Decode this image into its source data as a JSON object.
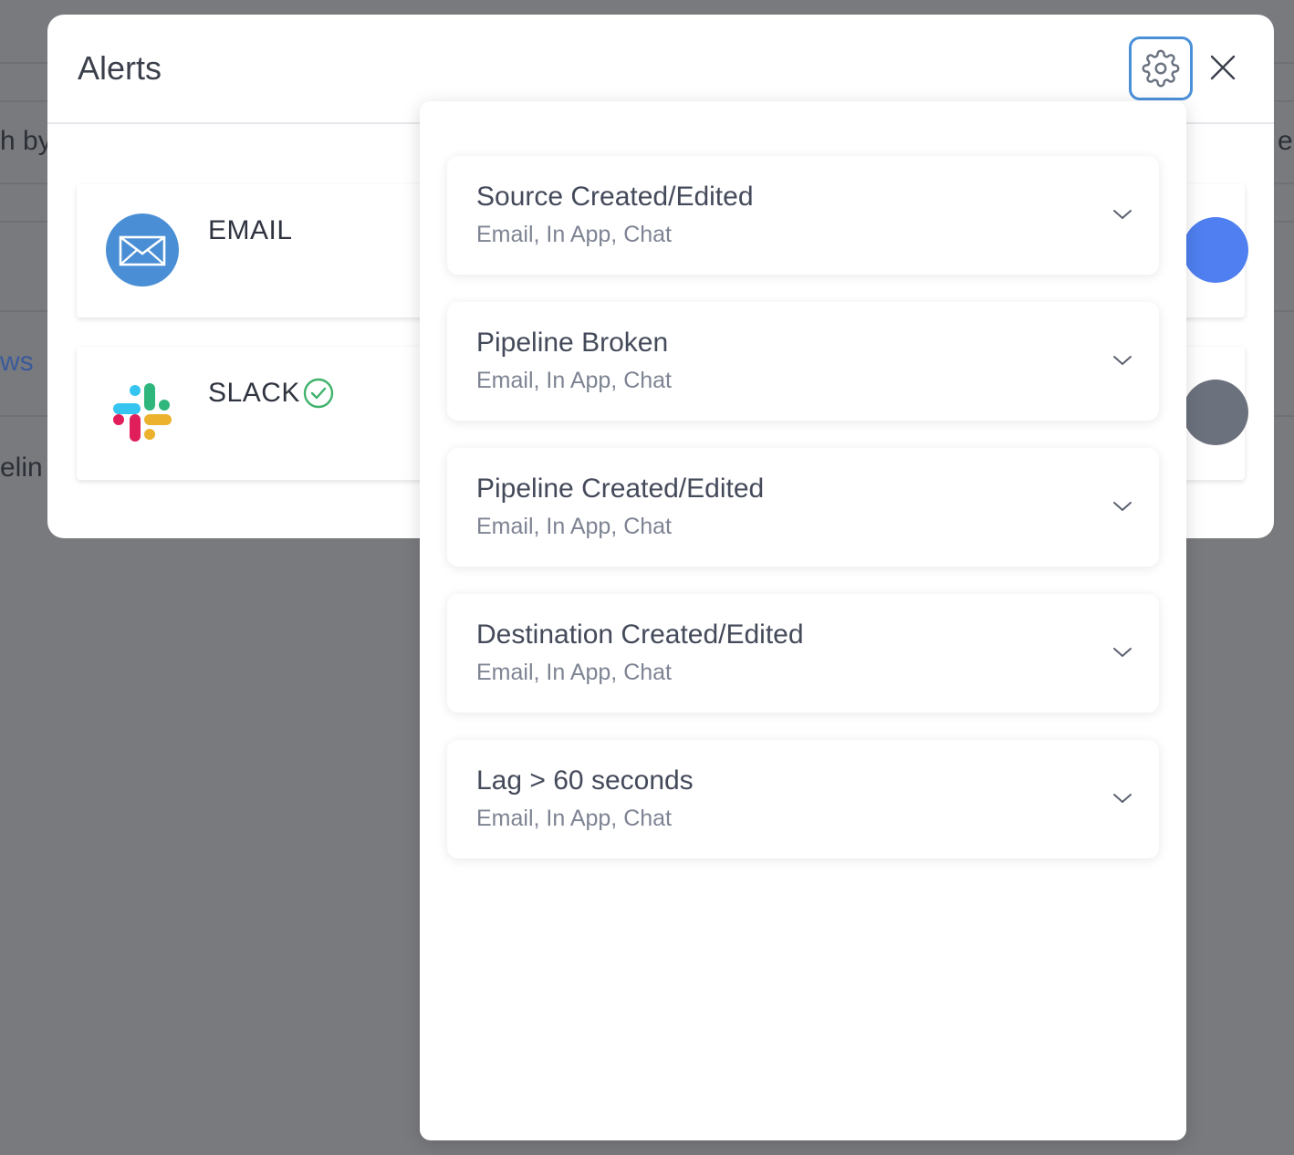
{
  "modal": {
    "title": "Alerts"
  },
  "background": {
    "frag1": "h by",
    "frag2": "ws",
    "frag3": "elin",
    "frag4": "e"
  },
  "channels": [
    {
      "label": "EMAIL",
      "icon": "envelope-icon",
      "connected": false,
      "enabled": true
    },
    {
      "label": "SLACK",
      "icon": "slack-icon",
      "connected": true,
      "enabled": false
    }
  ],
  "alert_settings": [
    {
      "title": "Source Created/Edited",
      "channels": "Email, In App, Chat"
    },
    {
      "title": "Pipeline Broken",
      "channels": "Email, In App, Chat"
    },
    {
      "title": "Pipeline Created/Edited",
      "channels": "Email, In App, Chat"
    },
    {
      "title": "Destination Created/Edited",
      "channels": "Email, In App, Chat"
    },
    {
      "title": "Lag > 60 seconds",
      "channels": "Email, In App, Chat"
    }
  ],
  "colors": {
    "accent": "#4a90d9",
    "toggle_on": "#4f7ff0",
    "toggle_off": "#6c727d",
    "connected": "#3fb26b"
  }
}
